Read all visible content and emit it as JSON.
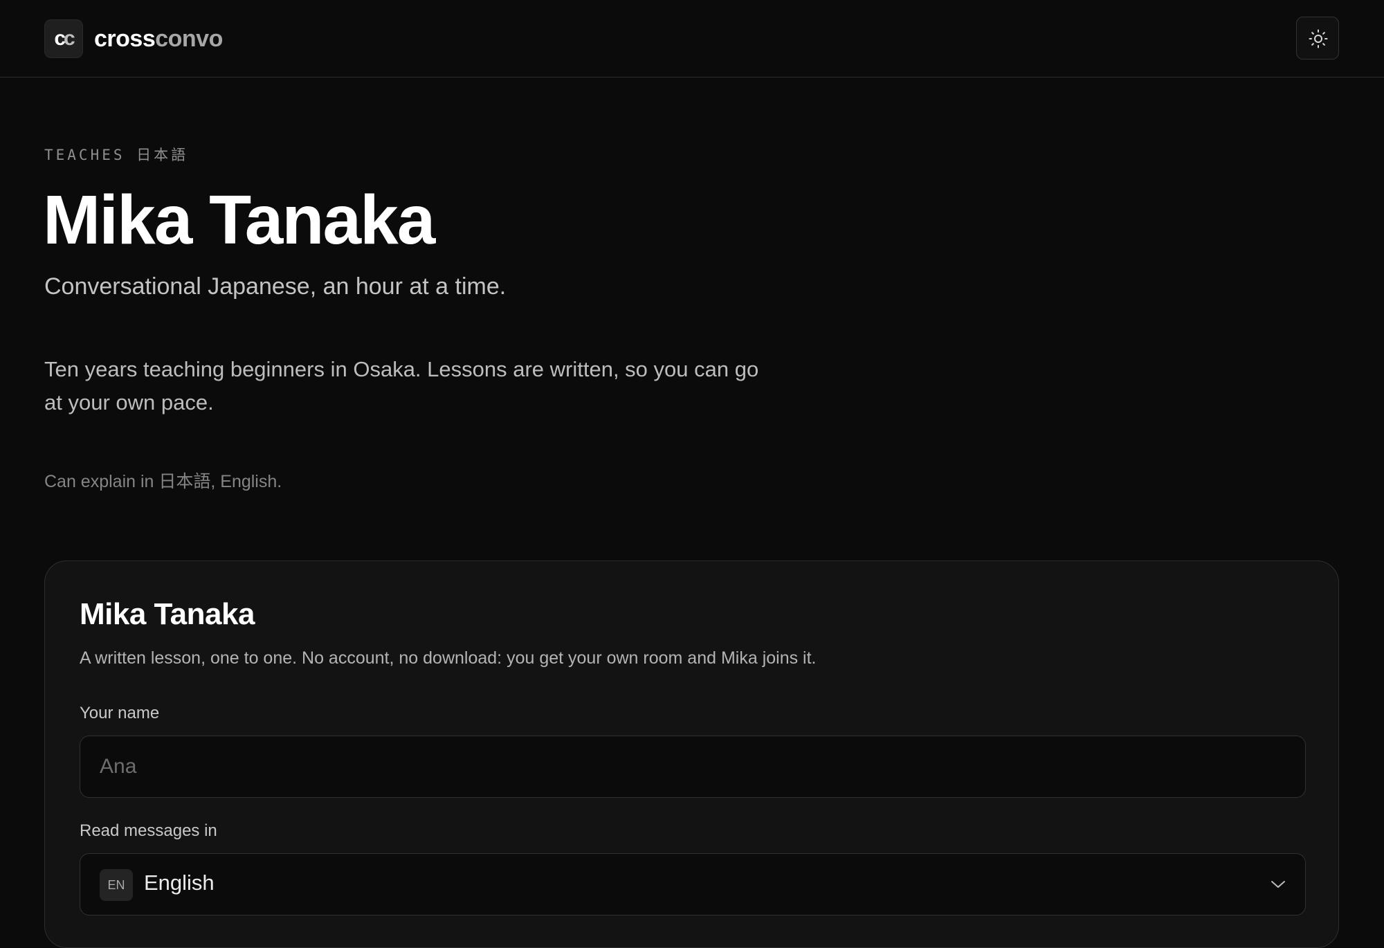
{
  "header": {
    "logo_text": "cc",
    "brand_part1": "cross",
    "brand_part2": "convo",
    "theme_toggle_icon": "sun-icon"
  },
  "hero": {
    "eyebrow": "TEACHES 日本語",
    "name": "Mika Tanaka",
    "tagline": "Conversational Japanese, an hour at a time.",
    "bio": "Ten years teaching beginners in Osaka. Lessons are written, so you can go at your own pace.",
    "explain": "Can explain in 日本語, English."
  },
  "card": {
    "title": "Mika Tanaka",
    "description": "A written lesson, one to one. No account, no download: you get your own room and Mika joins it.",
    "name_label": "Your name",
    "name_placeholder": "Ana",
    "language_label": "Read messages in",
    "language_code": "EN",
    "language_value": "English",
    "dropdown_icon": "chevron-down-icon"
  }
}
